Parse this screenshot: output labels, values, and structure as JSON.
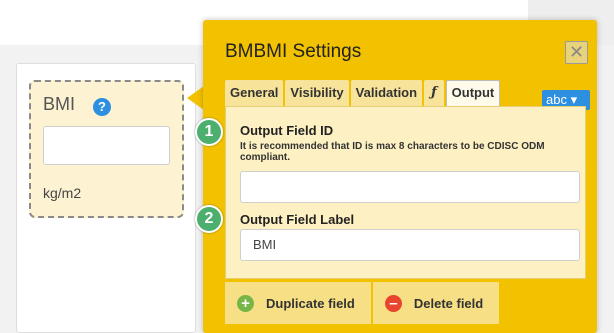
{
  "form": {
    "field_label": "BMI",
    "help_icon_glyph": "?",
    "unit": "kg/m2"
  },
  "panel": {
    "title": "BMBMI Settings",
    "close_glyph": "✕",
    "tabs": [
      {
        "label": "General"
      },
      {
        "label": "Visibility"
      },
      {
        "label": "Validation"
      },
      {
        "label": "ƒ"
      },
      {
        "label": "Output"
      }
    ],
    "active_tab": "Output",
    "type_menu_label": "abc ▾",
    "output_field_id": {
      "heading": "Output Field ID",
      "note": "It is recommended that ID is max 8 characters to be CDISC ODM compliant.",
      "value": ""
    },
    "output_field_label": {
      "heading": "Output Field Label",
      "value": "BMI"
    },
    "footer": {
      "duplicate_label": "Duplicate field",
      "delete_label": "Delete field",
      "plus_glyph": "+",
      "minus_glyph": "–"
    }
  },
  "badges": [
    "1",
    "2"
  ],
  "colors": {
    "panel": "#f2c200",
    "panel_body": "#fdf0c2",
    "accent_blue": "#2d8fe0",
    "badge_green": "#4caf6d",
    "add_green": "#77b646",
    "delete_red": "#e8452f"
  }
}
